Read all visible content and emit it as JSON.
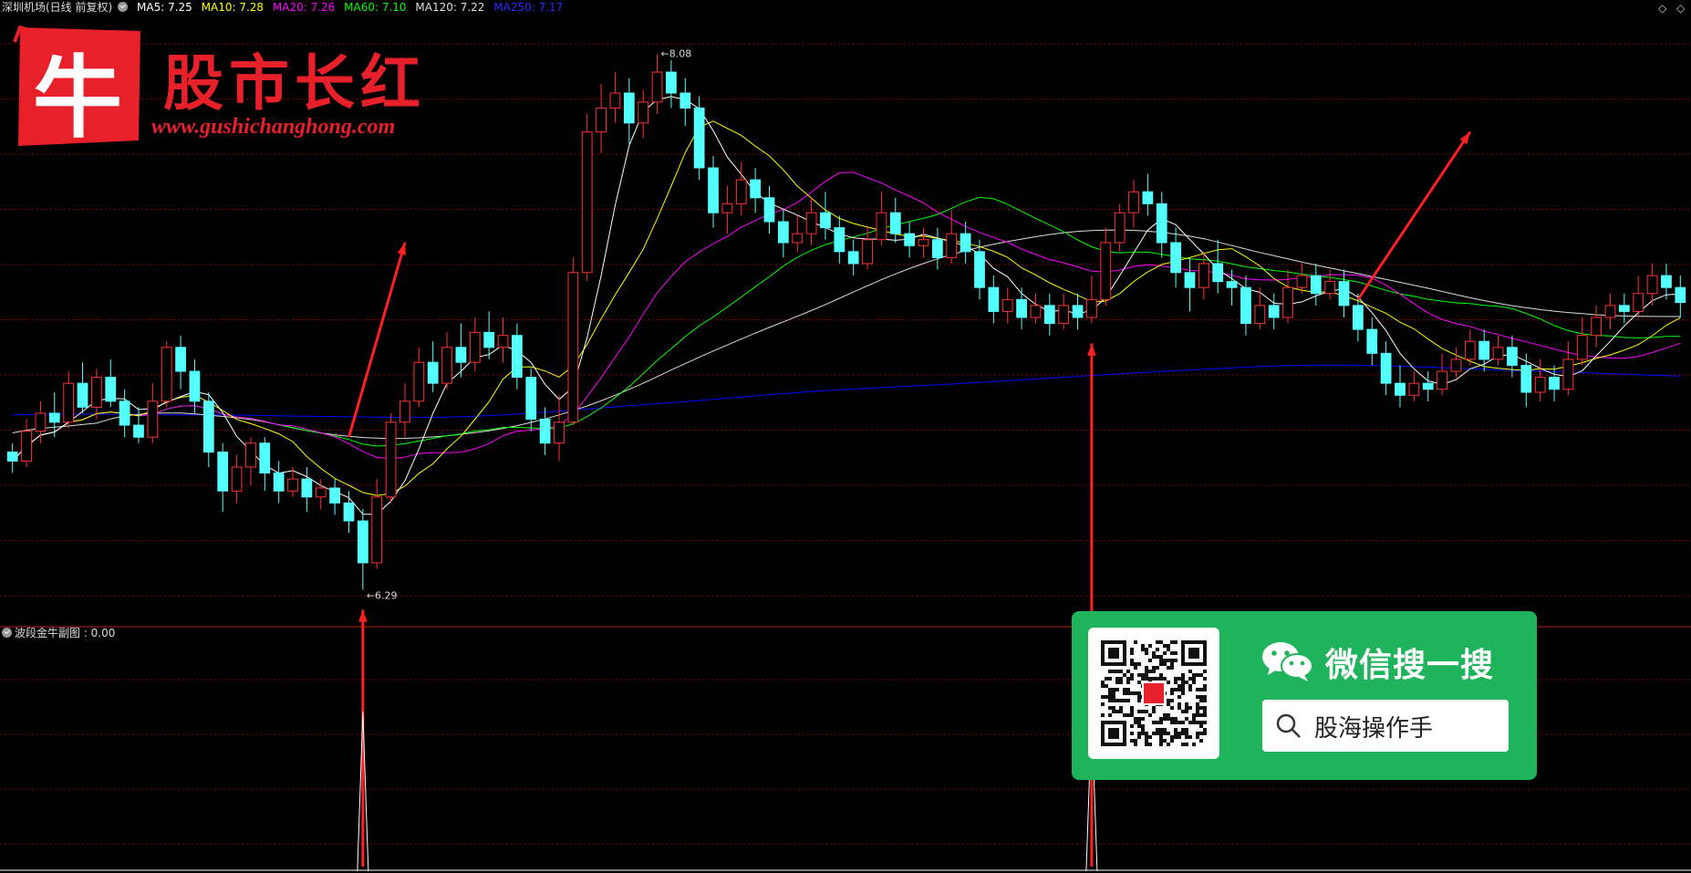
{
  "legend": {
    "title": "深圳机场(日线 前复权)",
    "items": [
      {
        "label": "MA5: 7.25",
        "color": "#ffffff"
      },
      {
        "label": "MA10: 7.28",
        "color": "#ffff00"
      },
      {
        "label": "MA20: 7.26",
        "color": "#ff00ff"
      },
      {
        "label": "MA60: 7.10",
        "color": "#00ff00"
      },
      {
        "label": "MA120: 7.22",
        "color": "#dddddd"
      },
      {
        "label": "MA250: 7.17",
        "color": "#0000ff"
      }
    ]
  },
  "sub_legend": "波段金牛副图 : 0.00",
  "logo": {
    "name": "股市长红",
    "url": "www.gushichanghong.com",
    "mark": "牛"
  },
  "wechat": {
    "title": "微信搜一搜",
    "search_text": "股海操作手"
  },
  "corner_icons": [
    "diamond-icon",
    "diamond-icon"
  ],
  "colors": {
    "up": "#ff3232",
    "down": "#54ffff",
    "grid": "#8b0000",
    "arrow": "#ff2020",
    "ma5": "#ffffff",
    "ma10": "#ffff00",
    "ma20": "#ff00ff",
    "ma60": "#00ff00",
    "ma120": "#dddddd",
    "ma250": "#0000ff"
  },
  "chart_data": {
    "type": "candlestick",
    "high_label": "8.08",
    "low_label": "6.29",
    "ylim": [
      6.2,
      8.2
    ],
    "candles": [
      [
        6.75,
        6.72,
        6.78,
        6.68
      ],
      [
        6.72,
        6.82,
        6.86,
        6.7
      ],
      [
        6.82,
        6.88,
        6.92,
        6.78
      ],
      [
        6.88,
        6.85,
        6.95,
        6.8
      ],
      [
        6.85,
        6.98,
        7.02,
        6.83
      ],
      [
        6.98,
        6.9,
        7.05,
        6.88
      ],
      [
        6.9,
        7.0,
        7.03,
        6.86
      ],
      [
        7.0,
        6.92,
        7.06,
        6.9
      ],
      [
        6.92,
        6.84,
        6.96,
        6.8
      ],
      [
        6.84,
        6.8,
        6.9,
        6.78
      ],
      [
        6.8,
        6.92,
        6.98,
        6.78
      ],
      [
        6.92,
        7.1,
        7.12,
        6.9
      ],
      [
        7.1,
        7.02,
        7.14,
        6.96
      ],
      [
        7.02,
        6.92,
        7.06,
        6.88
      ],
      [
        6.92,
        6.75,
        6.95,
        6.7
      ],
      [
        6.75,
        6.62,
        6.78,
        6.55
      ],
      [
        6.62,
        6.7,
        6.74,
        6.58
      ],
      [
        6.7,
        6.78,
        6.8,
        6.64
      ],
      [
        6.78,
        6.68,
        6.8,
        6.62
      ],
      [
        6.68,
        6.62,
        6.72,
        6.58
      ],
      [
        6.62,
        6.66,
        6.7,
        6.6
      ],
      [
        6.66,
        6.6,
        6.7,
        6.55
      ],
      [
        6.6,
        6.63,
        6.66,
        6.56
      ],
      [
        6.63,
        6.58,
        6.66,
        6.54
      ],
      [
        6.58,
        6.52,
        6.62,
        6.48
      ],
      [
        6.52,
        6.38,
        6.56,
        6.29
      ],
      [
        6.38,
        6.6,
        6.66,
        6.36
      ],
      [
        6.6,
        6.85,
        6.88,
        6.58
      ],
      [
        6.85,
        6.92,
        6.98,
        6.8
      ],
      [
        6.92,
        7.05,
        7.1,
        6.9
      ],
      [
        7.05,
        6.98,
        7.12,
        6.95
      ],
      [
        6.98,
        7.1,
        7.15,
        6.96
      ],
      [
        7.1,
        7.05,
        7.18,
        7.0
      ],
      [
        7.05,
        7.15,
        7.2,
        7.02
      ],
      [
        7.15,
        7.1,
        7.22,
        7.06
      ],
      [
        7.1,
        7.14,
        7.2,
        7.05
      ],
      [
        7.14,
        7.0,
        7.18,
        6.96
      ],
      [
        7.0,
        6.86,
        7.03,
        6.82
      ],
      [
        6.86,
        6.78,
        6.9,
        6.74
      ],
      [
        6.78,
        6.85,
        6.94,
        6.72
      ],
      [
        6.85,
        7.35,
        7.4,
        6.84
      ],
      [
        7.35,
        7.82,
        7.88,
        7.32
      ],
      [
        7.82,
        7.9,
        7.98,
        7.75
      ],
      [
        7.9,
        7.95,
        8.02,
        7.85
      ],
      [
        7.95,
        7.85,
        8.0,
        7.78
      ],
      [
        7.85,
        7.92,
        7.96,
        7.8
      ],
      [
        7.92,
        8.02,
        8.08,
        7.88
      ],
      [
        8.02,
        7.95,
        8.06,
        7.9
      ],
      [
        7.95,
        7.9,
        8.0,
        7.84
      ],
      [
        7.9,
        7.7,
        7.94,
        7.66
      ],
      [
        7.7,
        7.55,
        7.74,
        7.5
      ],
      [
        7.55,
        7.58,
        7.64,
        7.48
      ],
      [
        7.58,
        7.66,
        7.72,
        7.54
      ],
      [
        7.66,
        7.6,
        7.7,
        7.55
      ],
      [
        7.6,
        7.52,
        7.64,
        7.48
      ],
      [
        7.52,
        7.45,
        7.56,
        7.4
      ],
      [
        7.45,
        7.48,
        7.54,
        7.42
      ],
      [
        7.48,
        7.55,
        7.6,
        7.44
      ],
      [
        7.55,
        7.5,
        7.62,
        7.46
      ],
      [
        7.5,
        7.42,
        7.54,
        7.38
      ],
      [
        7.42,
        7.38,
        7.46,
        7.34
      ],
      [
        7.38,
        7.46,
        7.5,
        7.36
      ],
      [
        7.46,
        7.55,
        7.62,
        7.44
      ],
      [
        7.55,
        7.48,
        7.6,
        7.45
      ],
      [
        7.48,
        7.44,
        7.52,
        7.4
      ],
      [
        7.44,
        7.46,
        7.5,
        7.4
      ],
      [
        7.46,
        7.4,
        7.5,
        7.36
      ],
      [
        7.4,
        7.48,
        7.56,
        7.38
      ],
      [
        7.48,
        7.42,
        7.52,
        7.38
      ],
      [
        7.42,
        7.3,
        7.46,
        7.26
      ],
      [
        7.3,
        7.22,
        7.34,
        7.18
      ],
      [
        7.22,
        7.26,
        7.3,
        7.18
      ],
      [
        7.26,
        7.2,
        7.3,
        7.16
      ],
      [
        7.2,
        7.24,
        7.28,
        7.18
      ],
      [
        7.24,
        7.18,
        7.28,
        7.14
      ],
      [
        7.18,
        7.24,
        7.28,
        7.16
      ],
      [
        7.24,
        7.2,
        7.28,
        7.16
      ],
      [
        7.2,
        7.26,
        7.34,
        7.18
      ],
      [
        7.26,
        7.45,
        7.5,
        7.24
      ],
      [
        7.45,
        7.55,
        7.58,
        7.42
      ],
      [
        7.55,
        7.62,
        7.66,
        7.5
      ],
      [
        7.62,
        7.58,
        7.68,
        7.54
      ],
      [
        7.58,
        7.45,
        7.62,
        7.4
      ],
      [
        7.45,
        7.35,
        7.5,
        7.3
      ],
      [
        7.35,
        7.3,
        7.4,
        7.22
      ],
      [
        7.3,
        7.38,
        7.42,
        7.26
      ],
      [
        7.38,
        7.32,
        7.46,
        7.28
      ],
      [
        7.32,
        7.3,
        7.36,
        7.24
      ],
      [
        7.3,
        7.18,
        7.34,
        7.14
      ],
      [
        7.18,
        7.24,
        7.3,
        7.16
      ],
      [
        7.24,
        7.2,
        7.28,
        7.16
      ],
      [
        7.2,
        7.3,
        7.36,
        7.18
      ],
      [
        7.3,
        7.34,
        7.38,
        7.28
      ],
      [
        7.34,
        7.28,
        7.38,
        7.24
      ],
      [
        7.28,
        7.32,
        7.36,
        7.26
      ],
      [
        7.32,
        7.24,
        7.36,
        7.2
      ],
      [
        7.24,
        7.16,
        7.28,
        7.12
      ],
      [
        7.16,
        7.08,
        7.2,
        7.04
      ],
      [
        7.08,
        6.98,
        7.12,
        6.94
      ],
      [
        6.98,
        6.94,
        7.04,
        6.9
      ],
      [
        6.94,
        6.98,
        7.02,
        6.92
      ],
      [
        6.98,
        6.96,
        7.02,
        6.92
      ],
      [
        6.96,
        7.02,
        7.08,
        6.94
      ],
      [
        7.02,
        7.06,
        7.1,
        7.0
      ],
      [
        7.06,
        7.12,
        7.16,
        7.04
      ],
      [
        7.12,
        7.06,
        7.16,
        7.02
      ],
      [
        7.06,
        7.1,
        7.14,
        7.04
      ],
      [
        7.1,
        7.04,
        7.14,
        7.0
      ],
      [
        7.04,
        6.95,
        7.08,
        6.9
      ],
      [
        6.95,
        7.0,
        7.06,
        6.92
      ],
      [
        7.0,
        6.96,
        7.04,
        6.92
      ],
      [
        6.96,
        7.06,
        7.12,
        6.94
      ],
      [
        7.06,
        7.14,
        7.2,
        7.04
      ],
      [
        7.14,
        7.2,
        7.24,
        7.1
      ],
      [
        7.2,
        7.24,
        7.28,
        7.16
      ],
      [
        7.24,
        7.22,
        7.28,
        7.18
      ],
      [
        7.22,
        7.28,
        7.34,
        7.2
      ],
      [
        7.28,
        7.34,
        7.38,
        7.24
      ],
      [
        7.34,
        7.3,
        7.38,
        7.26
      ],
      [
        7.3,
        7.25,
        7.34,
        7.2
      ]
    ],
    "signal_peaks": [
      25,
      77
    ],
    "sub_value": 0.0
  }
}
